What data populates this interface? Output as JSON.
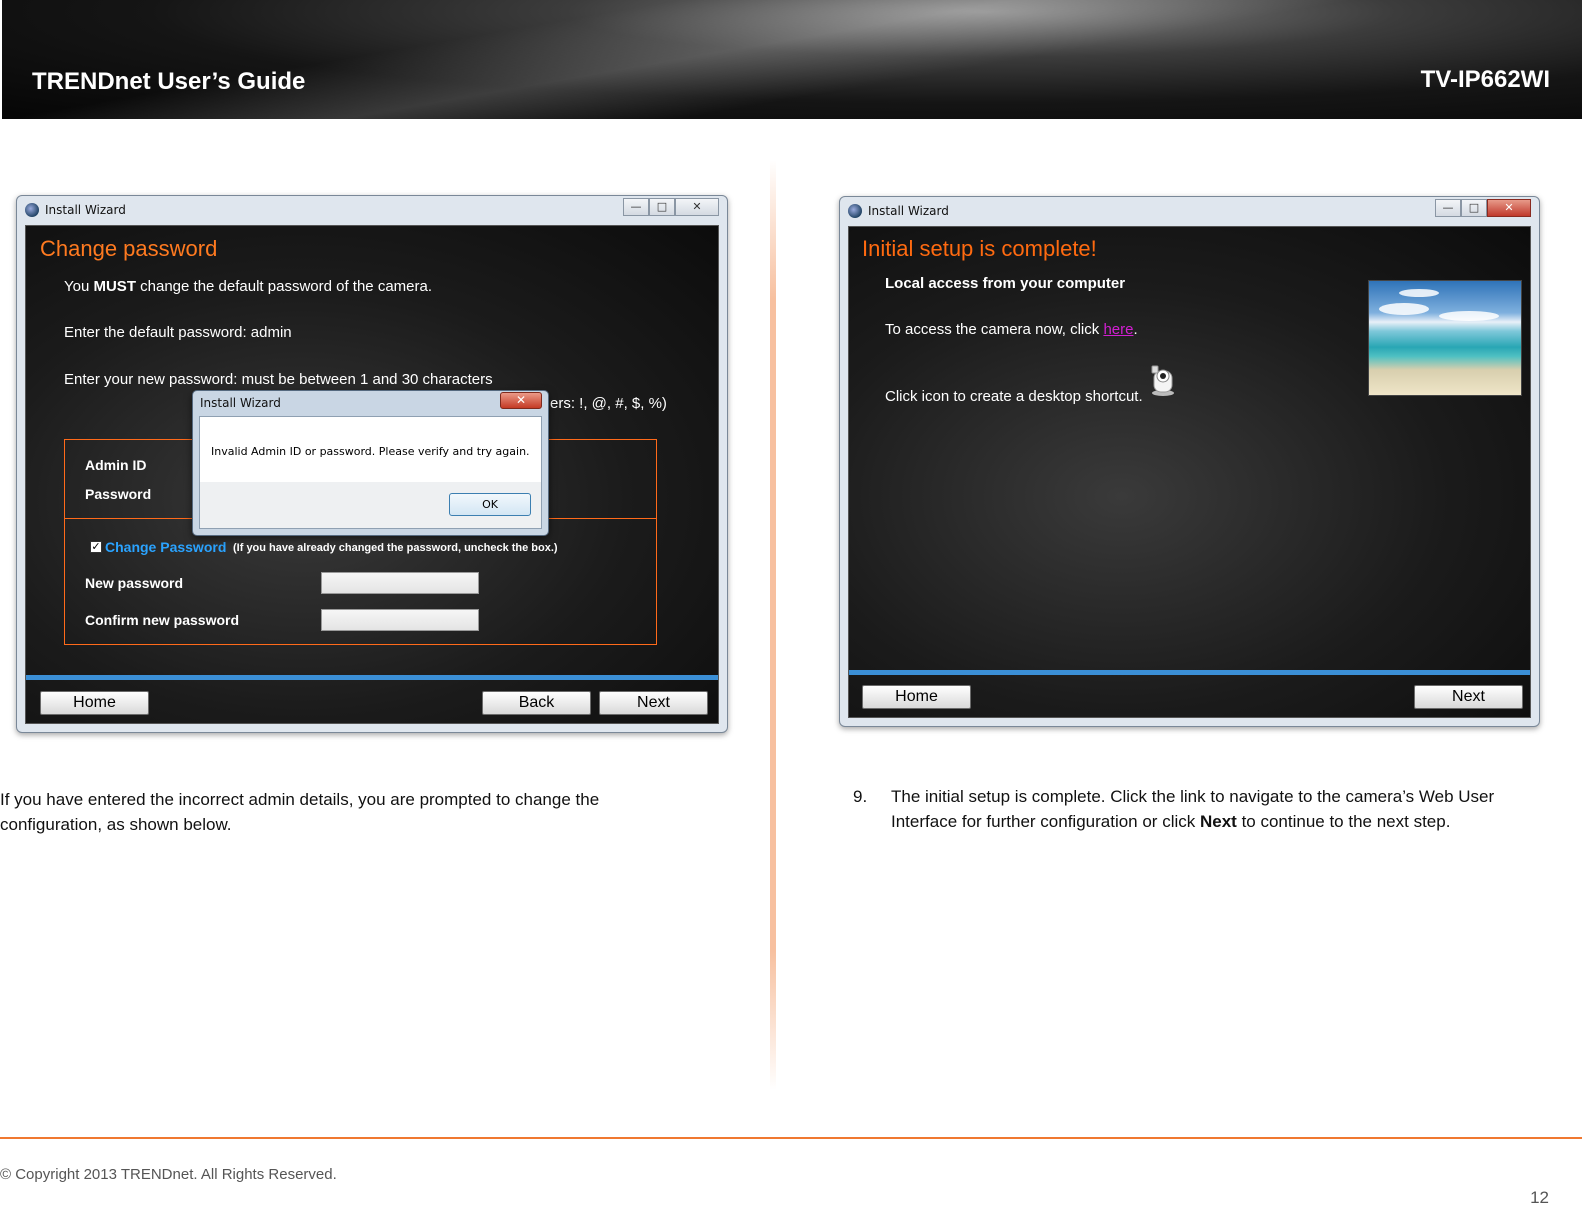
{
  "header": {
    "guide_title": "TRENDnet User’s Guide",
    "model": "TV-IP662WI"
  },
  "left_window": {
    "title": "Install Wizard",
    "heading": "Change password",
    "line1_prefix": "You ",
    "line1_bold": "MUST",
    "line1_suffix": " change the default password of the camera.",
    "line2": "Enter the default password: admin",
    "line3": "Enter your new password: must be between 1 and 30 characters",
    "line4_visible_tail": "ers: !, @, #, $, %)",
    "form": {
      "admin_id_label": "Admin ID",
      "password_label": "Password",
      "change_password_checked": true,
      "change_password_label": "Change Password",
      "change_password_note": "(If you have already changed the password, uncheck the box.)",
      "new_password_label": "New password",
      "confirm_password_label": "Confirm new password",
      "new_password_value": "",
      "confirm_password_value": ""
    },
    "buttons": {
      "home": "Home",
      "back": "Back",
      "next": "Next"
    },
    "dialog": {
      "title": "Install Wizard",
      "close": "✕",
      "message": "Invalid Admin ID or password. Please verify and try again.",
      "ok": "OK"
    },
    "controls": {
      "minimize": "—",
      "maximize": "□",
      "close": "✕"
    }
  },
  "right_window": {
    "title": "Install Wizard",
    "heading": "Initial setup is complete!",
    "subheading": "Local access from your computer",
    "access_prefix": "To access the camera now, click ",
    "access_link": "here",
    "access_suffix": ".",
    "shortcut_text": "Click icon to create a desktop shortcut.",
    "buttons": {
      "home": "Home",
      "next": "Next"
    },
    "controls": {
      "minimize": "—",
      "maximize": "□",
      "close": "✕"
    }
  },
  "left_caption": "If you have entered the incorrect admin details, you are prompted to change the configuration, as shown below.",
  "step": {
    "number": "9.",
    "text_before": "The initial setup is complete. Click the link to navigate to the camera’s Web User Interface for further configuration or click ",
    "bold": "Next",
    "text_after": " to continue to the next step."
  },
  "footer": {
    "copyright": "© Copyright 2013 TRENDnet. All Rights Reserved.",
    "page_number": "12"
  },
  "colors": {
    "accent_orange": "#ff7a20",
    "link_magenta": "#d21fd2",
    "blue_bar": "#3b8fd6",
    "change_password_blue": "#2aa3ff"
  }
}
